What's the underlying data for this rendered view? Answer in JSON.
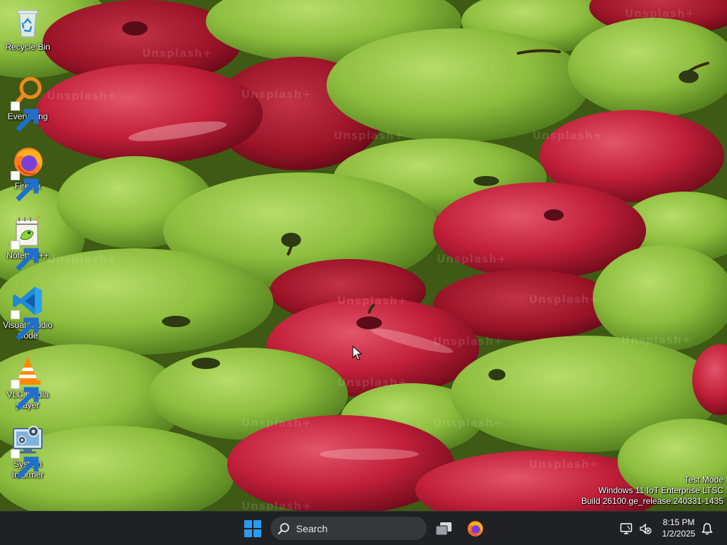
{
  "desktop": {
    "icons": [
      {
        "label": "Recycle Bin",
        "icon": "recycle-bin-icon"
      },
      {
        "label": "Everything",
        "icon": "everything-search-icon"
      },
      {
        "label": "Firefox",
        "icon": "firefox-icon"
      },
      {
        "label": "Notepad++",
        "icon": "notepad-plus-plus-icon"
      },
      {
        "label": "Visual Studio Code",
        "icon": "vscode-icon"
      },
      {
        "label": "VLC media player",
        "icon": "vlc-icon"
      },
      {
        "label": "System Informer",
        "icon": "system-informer-icon"
      }
    ],
    "wallpaper_watermark": "Unsplash+",
    "os_watermark": {
      "line1": "Test Mode",
      "line2": "Windows 11 IoT Enterprise LTSC",
      "line3": "Build 26100.ge_release.240331-1435"
    }
  },
  "taskbar": {
    "search_label": "Search",
    "clock": {
      "time": "8:15 PM",
      "date": "1/2/2025"
    },
    "accent": "#2b9af3",
    "background": "#1f2124"
  }
}
